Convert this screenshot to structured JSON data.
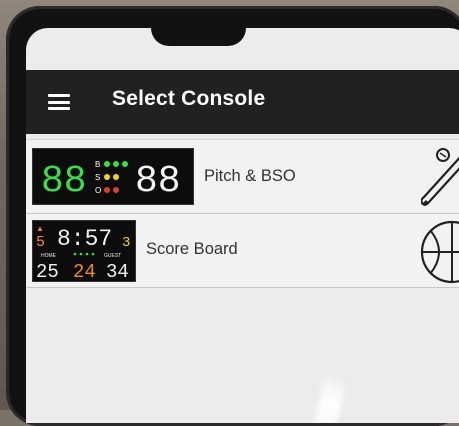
{
  "app": {
    "title": "Select Console"
  },
  "consoles": [
    {
      "label": "Pitch & BSO",
      "icon": "baseball-bat-icon",
      "thumb": {
        "left_digits": "88",
        "right_digits": "88",
        "rows": [
          "B",
          "S",
          "O"
        ]
      }
    },
    {
      "label": "Score Board",
      "icon": "basketball-icon",
      "thumb": {
        "clock": "8:57",
        "period": "3",
        "left_indicator": "5",
        "home_label": "HOME",
        "guest_label": "GUEST",
        "home_score": "25",
        "guest_score": "34",
        "shot_clock": "24"
      }
    }
  ],
  "colors": {
    "appbar": "#212121",
    "list_bg": "#f2f2f2",
    "led_green": "#35e04a",
    "led_white": "#f4f4f4",
    "led_orange": "#f08a1e",
    "led_yellow": "#f2d21b",
    "led_red": "#e03b2b"
  }
}
